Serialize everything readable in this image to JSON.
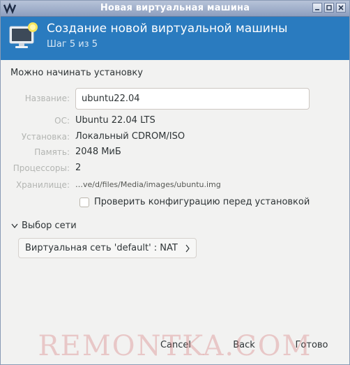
{
  "window": {
    "title": "Новая виртуальная машина",
    "controls": {
      "minimize": "minimize",
      "maximize": "maximize",
      "close": "close"
    }
  },
  "header": {
    "title": "Создание новой виртуальной машины",
    "step": "Шаг 5 из 5",
    "background_color": "#2a7bbf"
  },
  "ready_text": "Можно начинать установку",
  "fields": {
    "name_label": "Название:",
    "name_value": "ubuntu22.04",
    "os_label": "ОС:",
    "os_value": "Ubuntu 22.04 LTS",
    "install_label": "Установка:",
    "install_value": "Локальный CDROM/ISO",
    "memory_label": "Память:",
    "memory_value": "2048 МиБ",
    "cpus_label": "Процессоры:",
    "cpus_value": "2",
    "storage_label": "Хранилище:",
    "storage_value": "…ve/d/files/Media/images/ubuntu.img"
  },
  "customize_checkbox": {
    "label": "Проверить конфигурацию перед установкой",
    "checked": false
  },
  "network": {
    "expander_label": "Выбор сети",
    "selection": "Виртуальная сеть 'default' : NAT"
  },
  "buttons": {
    "cancel": "Cancel",
    "back": "Back",
    "finish": "Готово"
  },
  "watermark": "REMONTKA.COM"
}
